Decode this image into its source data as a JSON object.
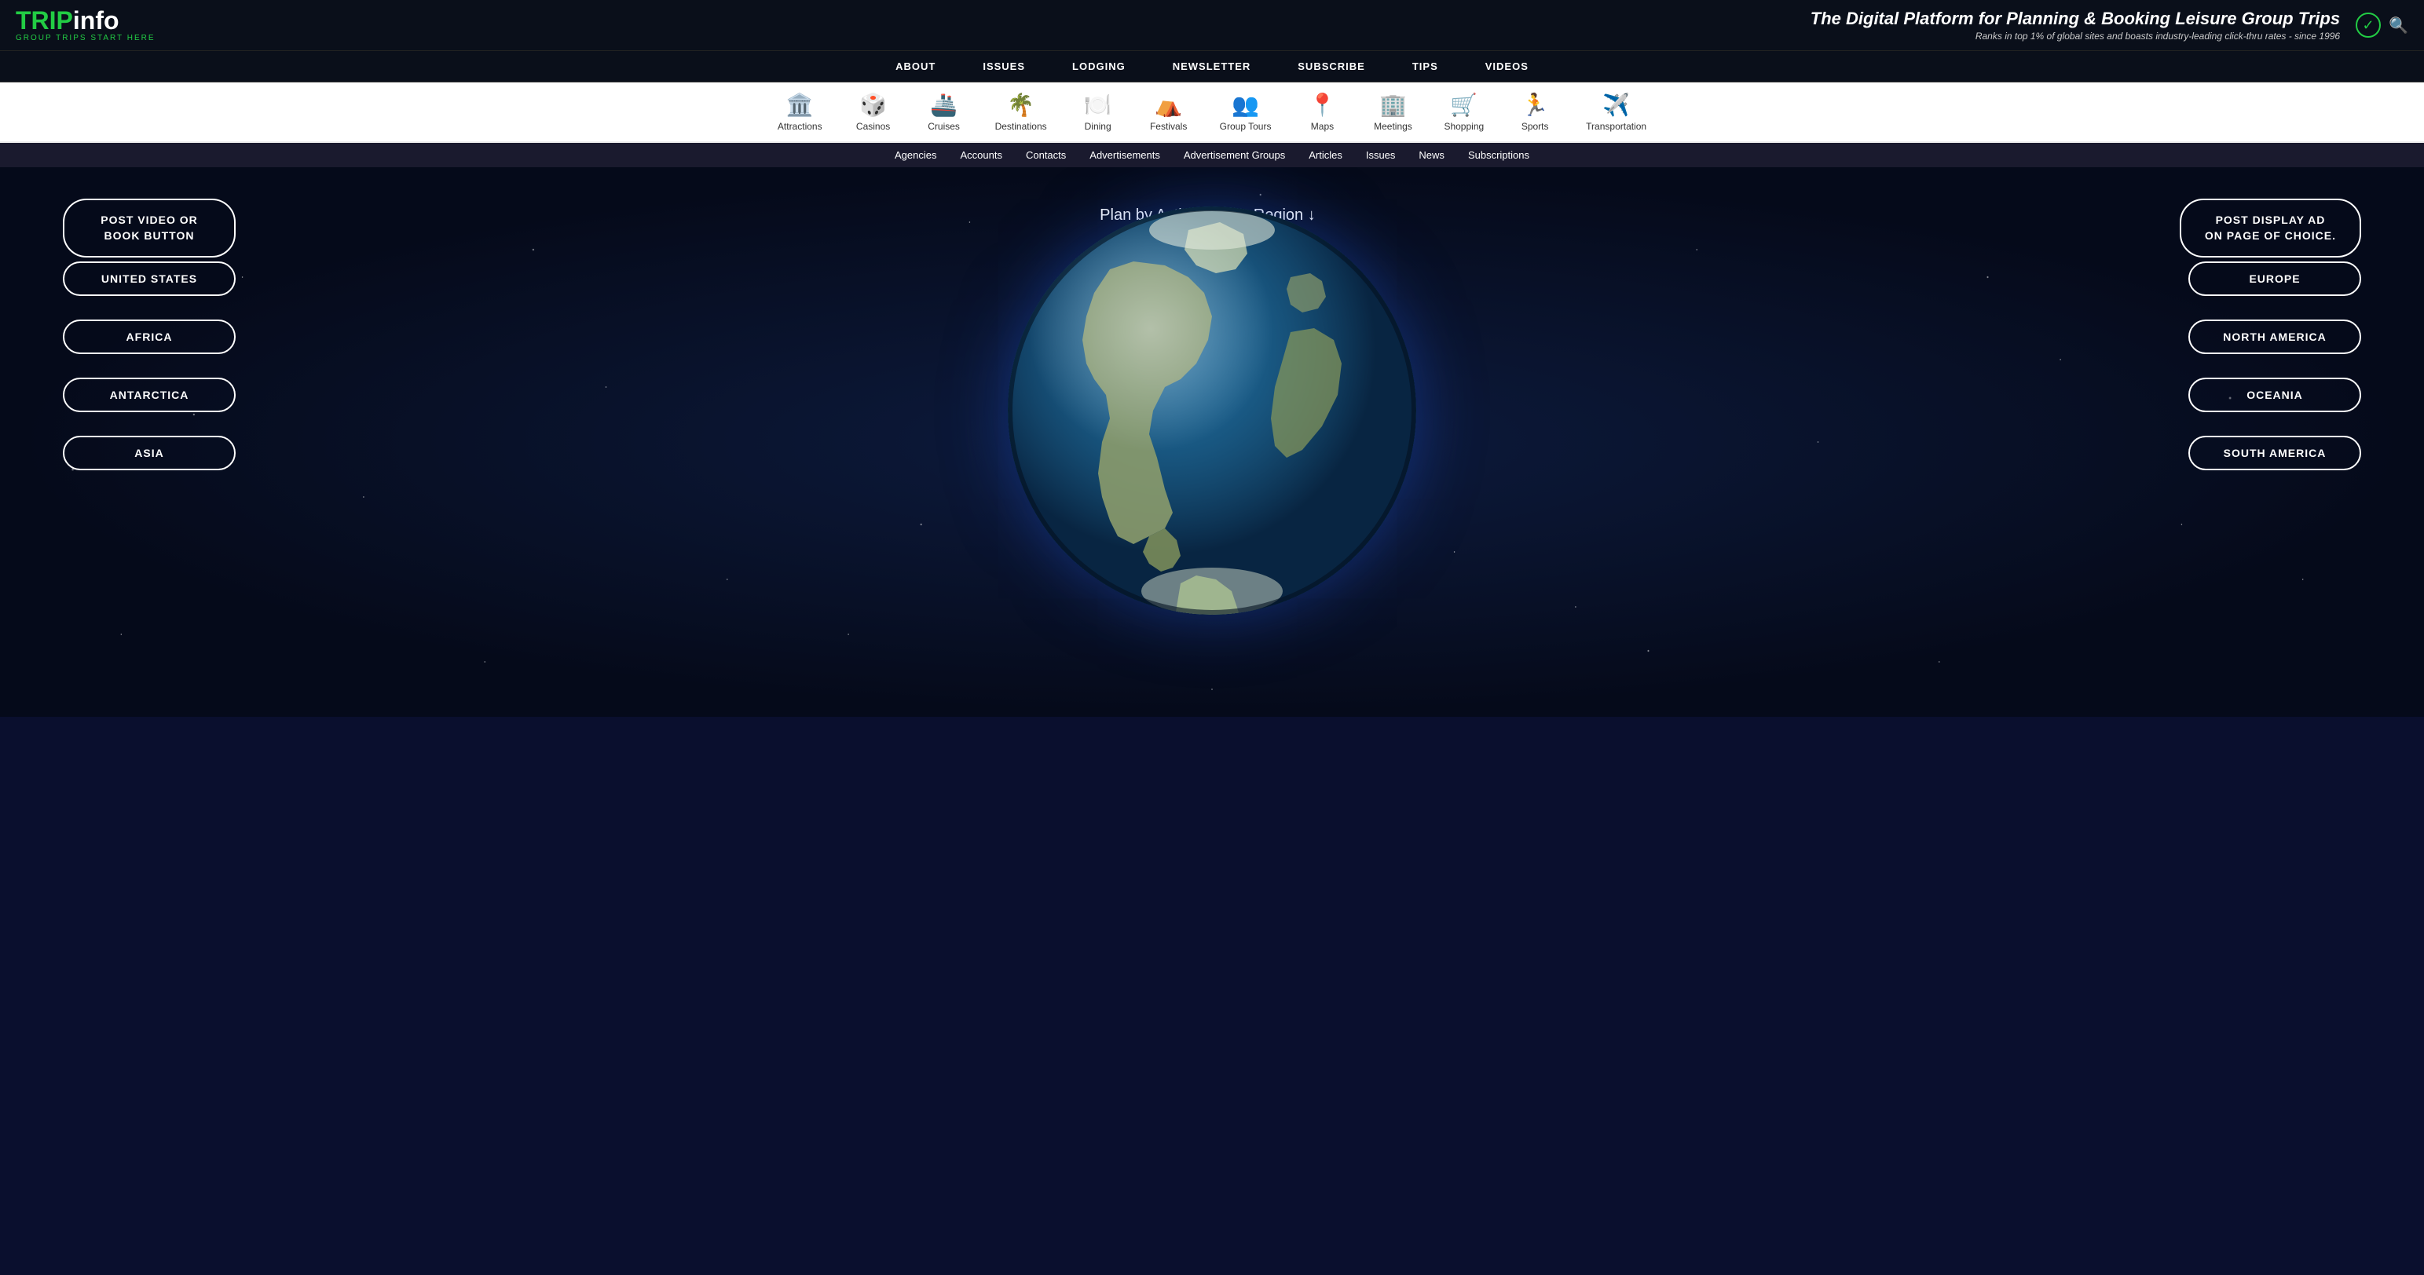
{
  "header": {
    "logo_trip": "TRIP",
    "logo_info": "info",
    "logo_sub": "GROUP TRIPS START HERE",
    "tagline": "The Digital Platform for Planning & Booking Leisure Group Trips",
    "sub_tagline": "Ranks in top 1% of global sites and boasts industry-leading click-thru rates - since 1996"
  },
  "nav": {
    "items": [
      {
        "label": "ABOUT",
        "id": "about"
      },
      {
        "label": "ISSUES",
        "id": "issues"
      },
      {
        "label": "LODGING",
        "id": "lodging"
      },
      {
        "label": "NEWSLETTER",
        "id": "newsletter"
      },
      {
        "label": "SUBSCRIBE",
        "id": "subscribe"
      },
      {
        "label": "TIPS",
        "id": "tips"
      },
      {
        "label": "VIDEOS",
        "id": "videos"
      }
    ]
  },
  "categories": [
    {
      "label": "Attractions",
      "icon": "🏛️",
      "color": "#cc4400"
    },
    {
      "label": "Casinos",
      "icon": "🎲",
      "color": "#ccaa00"
    },
    {
      "label": "Cruises",
      "icon": "🚢",
      "color": "#0055cc"
    },
    {
      "label": "Destinations",
      "icon": "🌴",
      "color": "#00aa44"
    },
    {
      "label": "Dining",
      "icon": "🍽️",
      "color": "#cc0044"
    },
    {
      "label": "Festivals",
      "icon": "🎪",
      "color": "#cc6600"
    },
    {
      "label": "Group Tours",
      "icon": "👥",
      "color": "#333333"
    },
    {
      "label": "Maps",
      "icon": "📍",
      "color": "#00aacc"
    },
    {
      "label": "Meetings",
      "icon": "🏢",
      "color": "#6600cc"
    },
    {
      "label": "Shopping",
      "icon": "🛒",
      "color": "#0066cc"
    },
    {
      "label": "Sports",
      "icon": "🏃",
      "color": "#cc6600"
    },
    {
      "label": "Transportation",
      "icon": "✈️",
      "color": "#334455"
    }
  ],
  "admin_bar": {
    "items": [
      "Agencies",
      "Accounts",
      "Contacts",
      "Advertisements",
      "Advertisement Groups",
      "Articles",
      "Issues",
      "News",
      "Subscriptions"
    ]
  },
  "main": {
    "plan_text": "Plan by Activity",
    "or_text": "or Region",
    "btn_post_video": "POST VIDEO OR\nBOOK BUTTON",
    "btn_post_display": "POST DISPLAY AD\nON PAGE OF CHOICE.",
    "left_regions": [
      "UNITED STATES",
      "AFRICA",
      "ANTARCTICA",
      "ASIA"
    ],
    "right_regions": [
      "EUROPE",
      "NORTH AMERICA",
      "OCEANIA",
      "SOUTH AMERICA"
    ]
  }
}
